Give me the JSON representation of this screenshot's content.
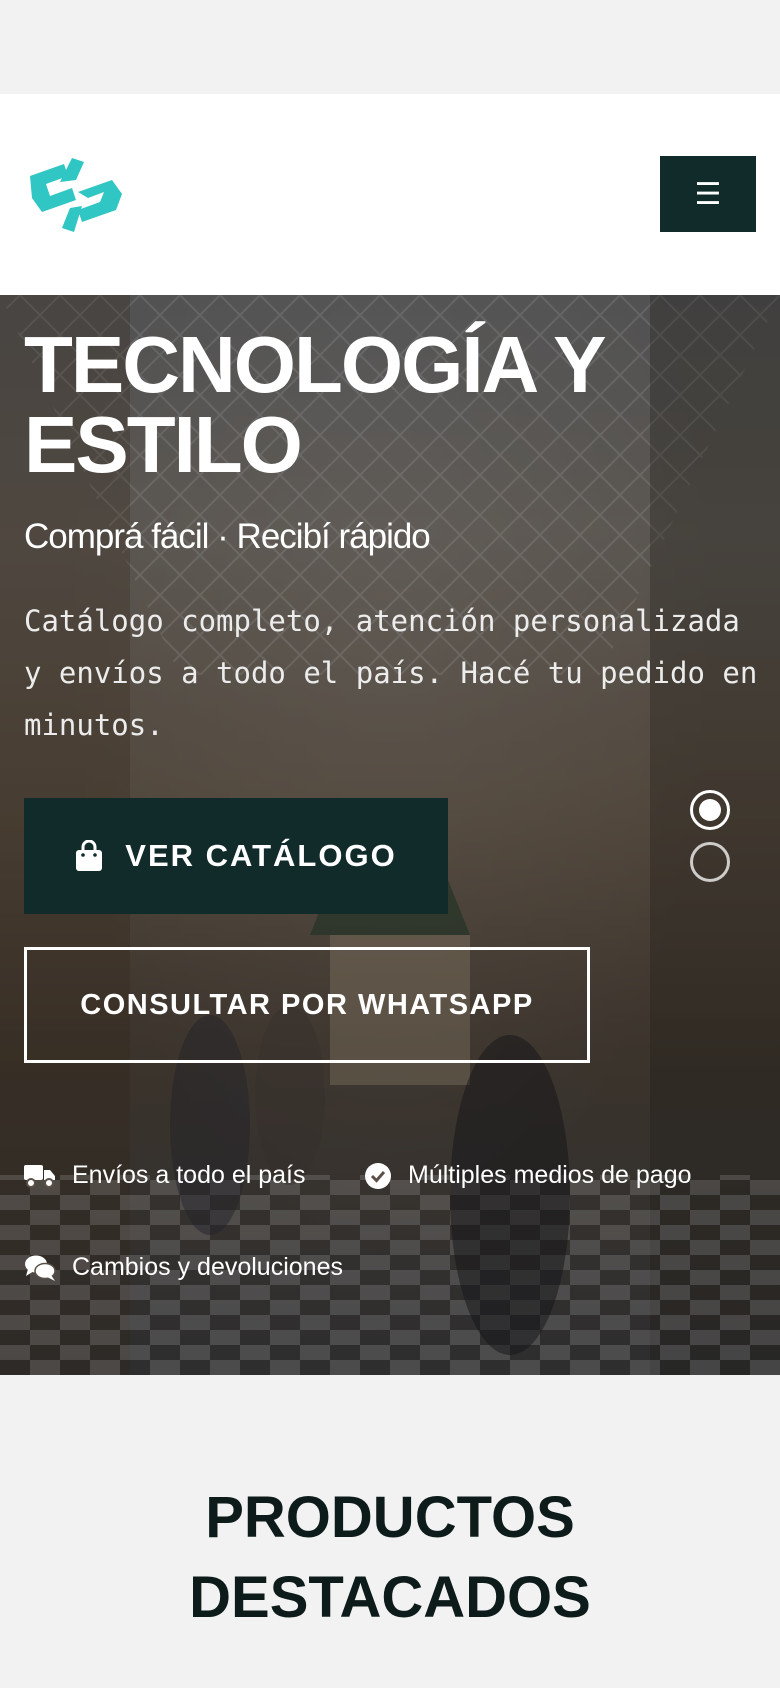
{
  "header": {
    "logo_icon": "brand-logo",
    "menu_icon": "hamburger-icon",
    "menu_symbol": "☰"
  },
  "hero": {
    "title": "TECNOLOGÍA Y ESTILO",
    "subtitle": "Comprá fácil · Recibí rápido",
    "description": "Catálogo completo, atención personalizada y envíos a todo el país. Hacé tu pedido en minutos.",
    "primary_button": "VER CATÁLOGO",
    "primary_button_icon": "shopping-bag-icon",
    "secondary_button": "CONSULTAR POR WHATSAPP",
    "slider": {
      "total_slides": 2,
      "active_slide": 1
    },
    "features": [
      {
        "icon": "truck-icon",
        "label": "Envíos a todo el país"
      },
      {
        "icon": "check-circle-icon",
        "label": "Múltiples medios de pago"
      },
      {
        "icon": "chat-icon",
        "label": "Cambios y devoluciones"
      }
    ]
  },
  "products_section": {
    "title": "PRODUCTOS DESTACADOS"
  },
  "colors": {
    "brand_teal": "#2fc6c3",
    "dark_button": "#112b2b",
    "heading_dark": "#0d1b1b"
  }
}
